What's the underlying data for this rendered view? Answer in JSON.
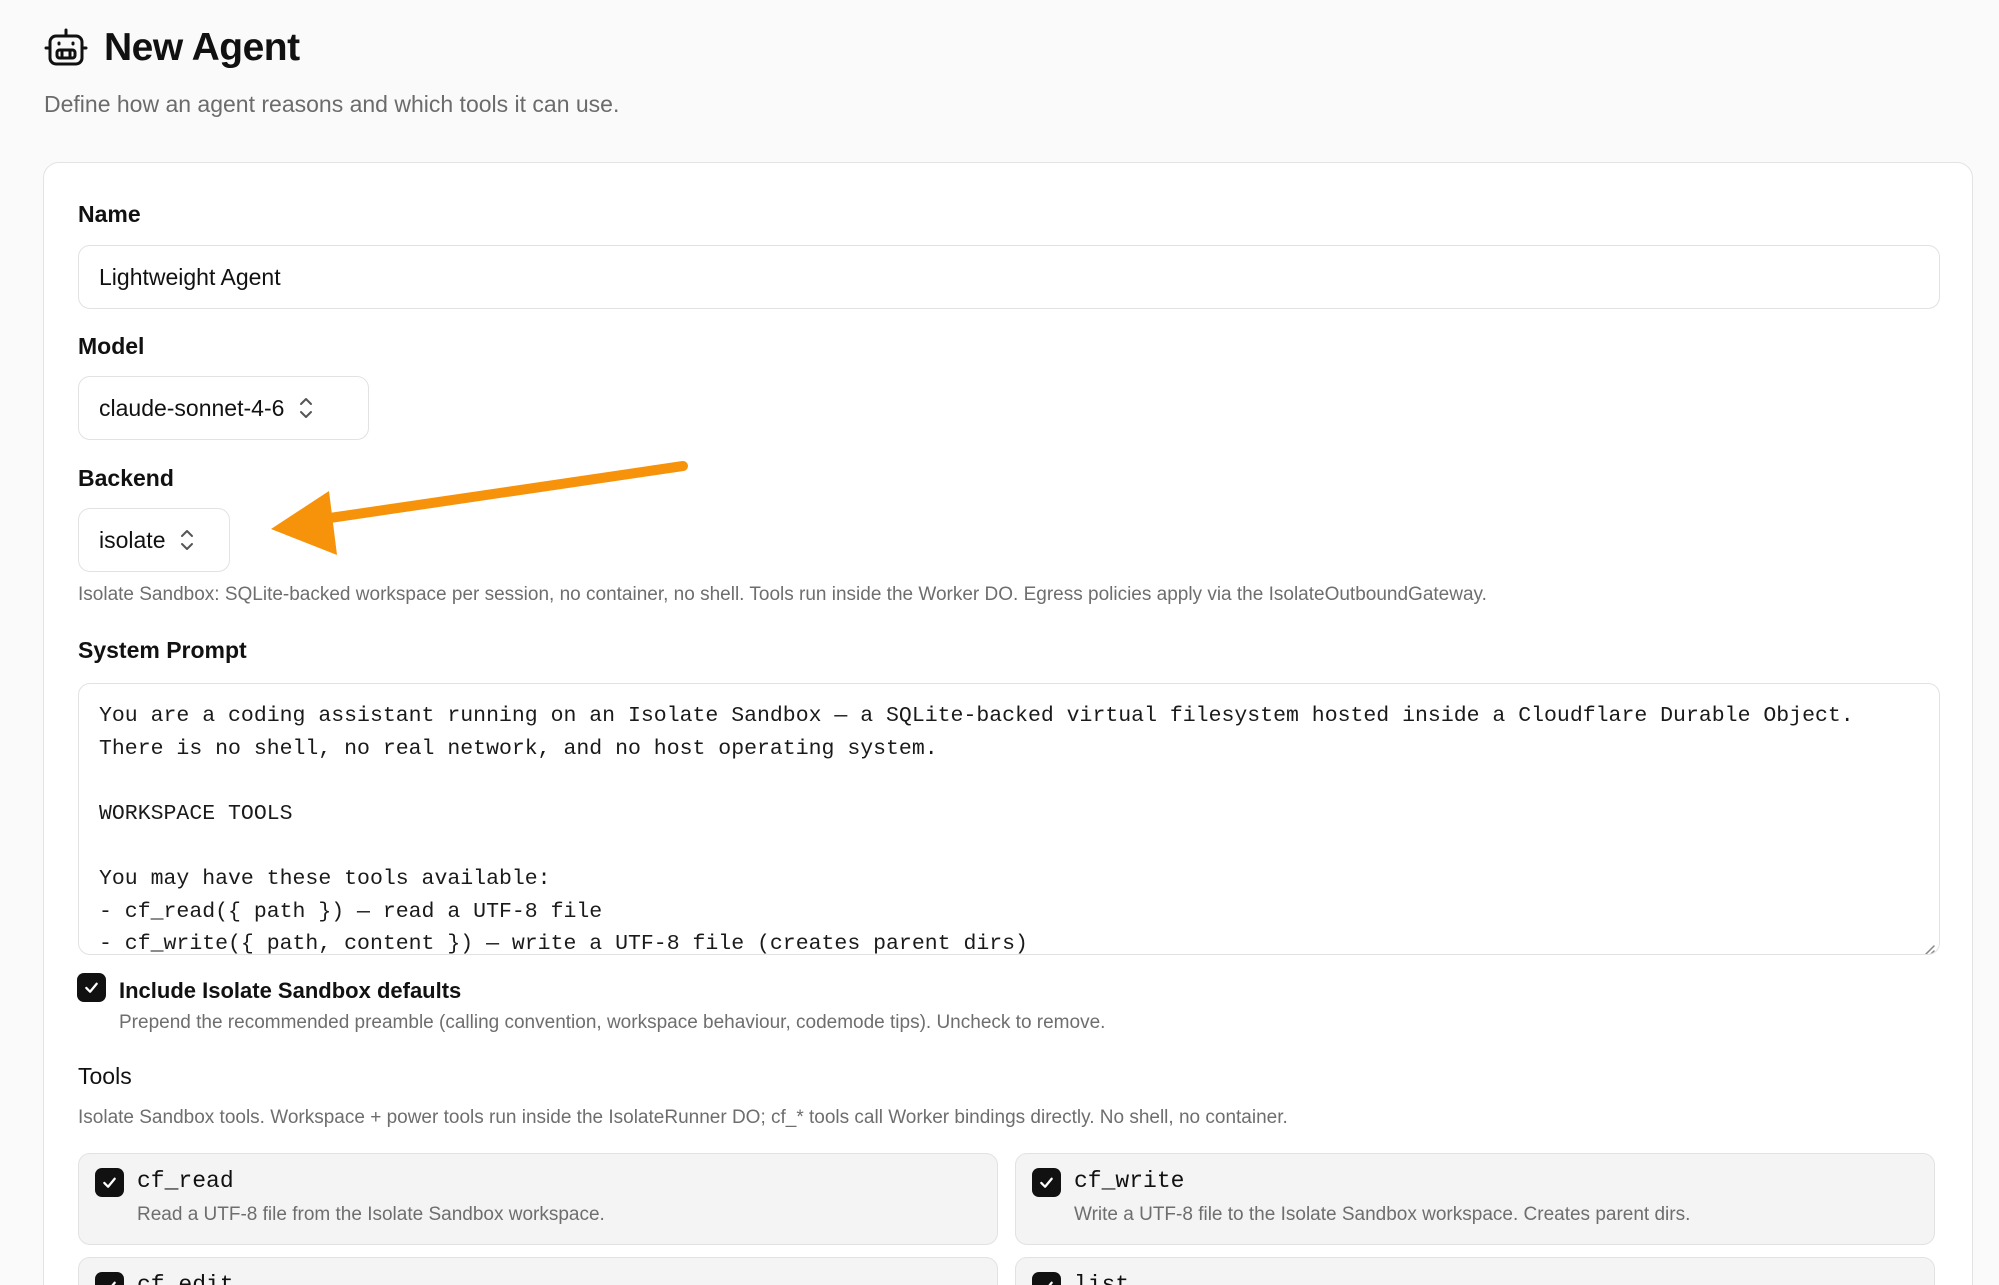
{
  "page": {
    "title": "New Agent",
    "subtitle": "Define how an agent reasons and which tools it can use.",
    "icon": "robot-icon"
  },
  "form": {
    "name": {
      "label": "Name",
      "value": "Lightweight Agent"
    },
    "model": {
      "label": "Model",
      "value": "claude-sonnet-4-6"
    },
    "backend": {
      "label": "Backend",
      "value": "isolate",
      "help": "Isolate Sandbox: SQLite-backed workspace per session, no container, no shell. Tools run inside the Worker DO. Egress policies apply via the IsolateOutboundGateway."
    },
    "system_prompt": {
      "label": "System Prompt",
      "lines": [
        "You are a coding assistant running on an Isolate Sandbox — a SQLite-backed virtual filesystem hosted inside a Cloudflare Durable Object.",
        "There is no shell, no real network, and no host operating system.",
        "",
        "WORKSPACE TOOLS",
        "",
        "You may have these tools available:",
        "- cf_read({ path }) — read a UTF-8 file",
        "- cf_write({ path, content }) — write a UTF-8 file (creates parent dirs)"
      ]
    },
    "defaults": {
      "checked": true,
      "label": "Include Isolate Sandbox defaults",
      "description": "Prepend the recommended preamble (calling convention, workspace behaviour, codemode tips). Uncheck to remove."
    },
    "tools": {
      "label": "Tools",
      "help": "Isolate Sandbox tools. Workspace + power tools run inside the IsolateRunner DO; cf_* tools call Worker bindings directly. No shell, no container.",
      "items": [
        {
          "name": "cf_read",
          "description": "Read a UTF-8 file from the Isolate Sandbox workspace.",
          "checked": true
        },
        {
          "name": "cf_write",
          "description": "Write a UTF-8 file to the Isolate Sandbox workspace. Creates parent dirs.",
          "checked": true
        },
        {
          "name": "cf_edit",
          "description": "",
          "checked": true
        },
        {
          "name": "list",
          "description": "",
          "checked": true
        }
      ]
    }
  },
  "colors": {
    "accent_arrow": "#F7930B",
    "checkbox": "#111111",
    "muted_text": "#6E6E6E"
  }
}
